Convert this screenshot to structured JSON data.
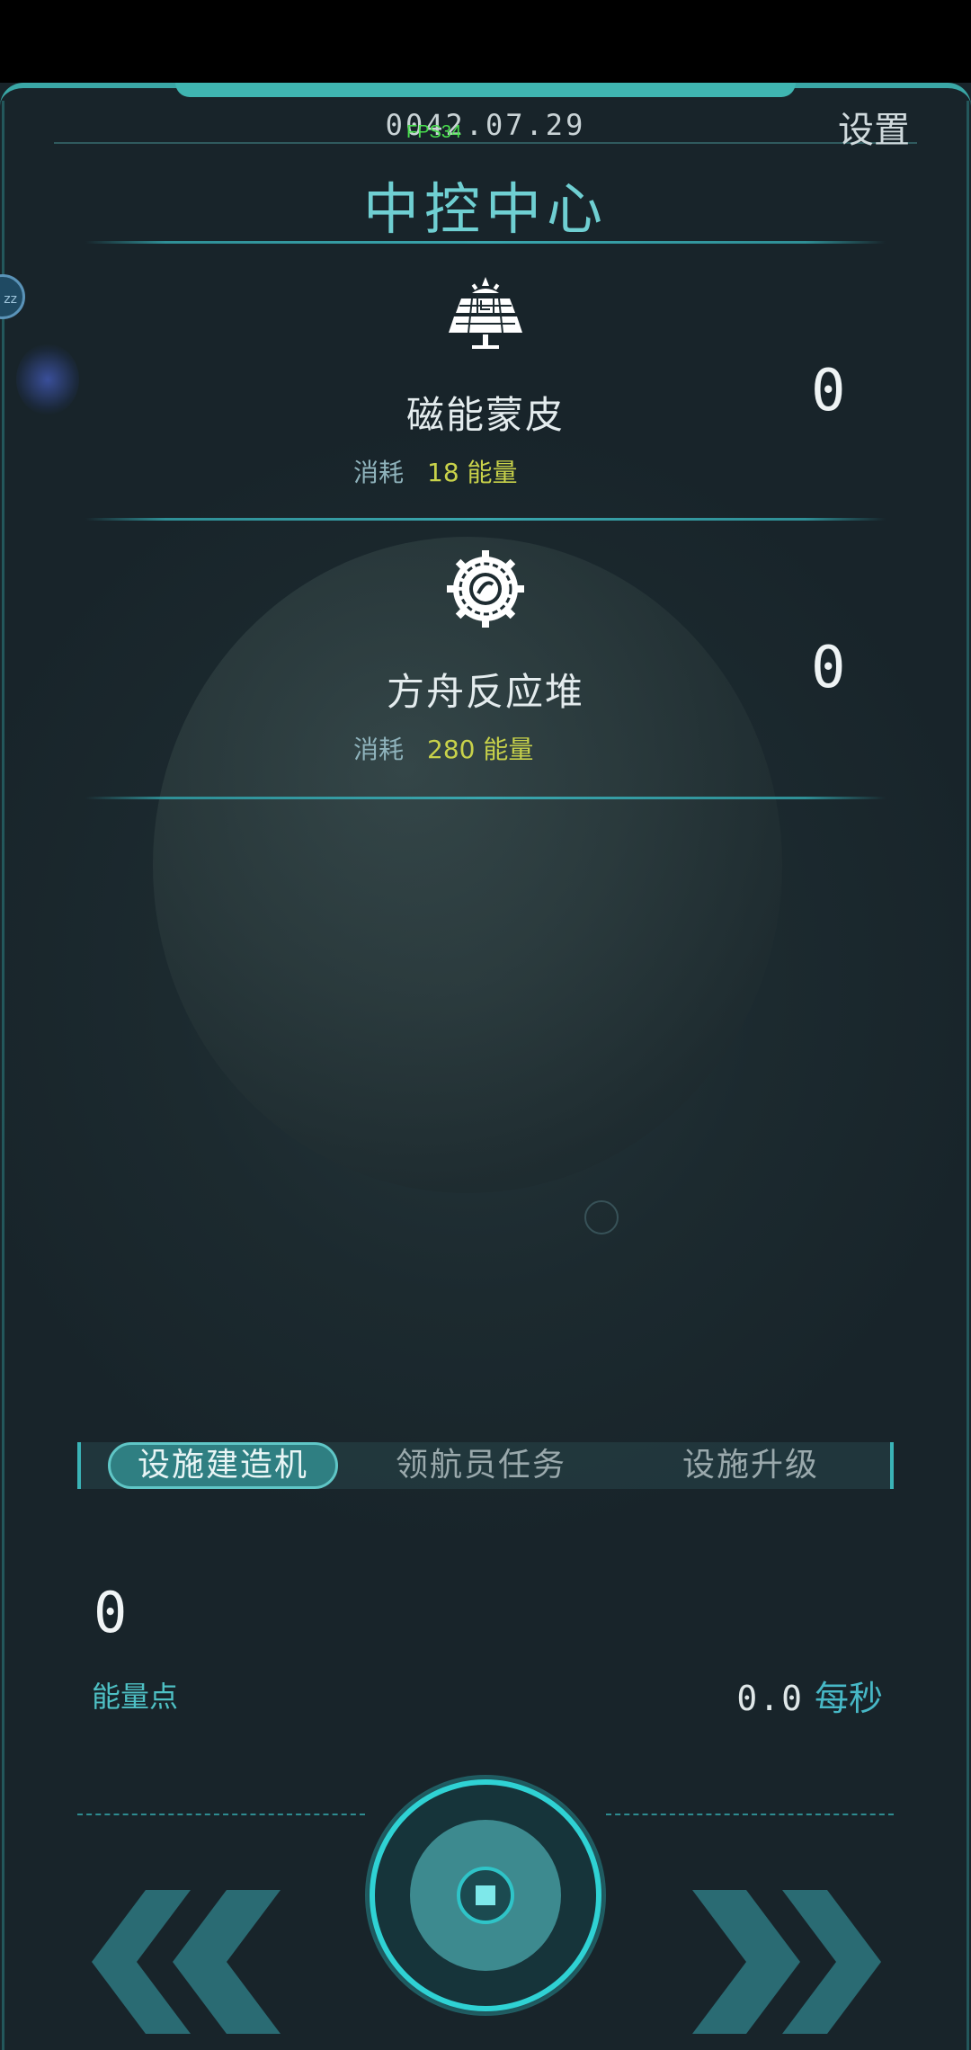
{
  "header": {
    "date": "0042.07.29",
    "fps": "FPS34",
    "settings_label": "设置",
    "title": "中控中心",
    "left_badge": "zz"
  },
  "facilities": [
    {
      "icon": "solar-panel-icon",
      "name": "磁能蒙皮",
      "cost_label": "消耗",
      "cost_value": "18 能量",
      "count": "0"
    },
    {
      "icon": "reactor-gear-icon",
      "name": "方舟反应堆",
      "cost_label": "消耗",
      "cost_value": "280 能量",
      "count": "0"
    }
  ],
  "tabs": [
    {
      "label": "设施建造机",
      "active": true
    },
    {
      "label": "领航员任务",
      "active": false
    },
    {
      "label": "设施升级",
      "active": false
    }
  ],
  "energy": {
    "value": "0",
    "label": "能量点",
    "rate_value": "0.0",
    "rate_unit": "每秒"
  },
  "controls": {
    "prev_icon": "double-chevron-left-icon",
    "next_icon": "double-chevron-right-icon",
    "main_icon": "core-button-icon"
  },
  "colors": {
    "accent": "#3aa7a6",
    "cost_value": "#c8d24a",
    "energy_label": "#4ec0c4",
    "fps": "#49e04e"
  }
}
